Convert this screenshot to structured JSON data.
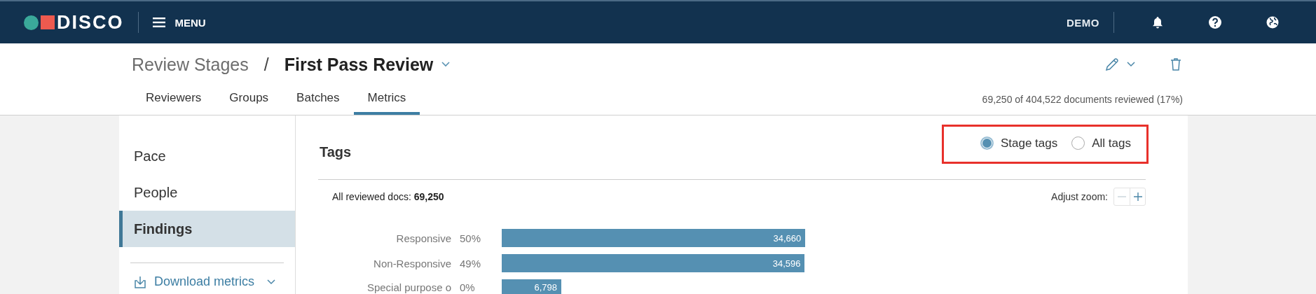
{
  "header": {
    "logo": "DISCO",
    "menu": "MENU",
    "user": "DEMO"
  },
  "breadcrumb": {
    "parent": "Review Stages",
    "separator": "/",
    "current": "First Pass Review"
  },
  "tabs": [
    {
      "label": "Reviewers",
      "selected": false
    },
    {
      "label": "Groups",
      "selected": false
    },
    {
      "label": "Batches",
      "selected": false
    },
    {
      "label": "Metrics",
      "selected": true
    }
  ],
  "progress_text": "69,250 of 404,522 documents reviewed (17%)",
  "sidebar": {
    "items": [
      {
        "label": "Pace",
        "selected": false
      },
      {
        "label": "People",
        "selected": false
      },
      {
        "label": "Findings",
        "selected": true
      }
    ],
    "download": "Download metrics"
  },
  "panel": {
    "title": "Tags",
    "radios": [
      {
        "label": "Stage tags",
        "selected": true
      },
      {
        "label": "All tags",
        "selected": false
      }
    ],
    "summary": "All reviewed docs: **69,250**",
    "zoom_label": "Adjust zoom:",
    "rows": [
      {
        "label": "Responsive",
        "percent": "50%",
        "count": "34,660"
      },
      {
        "label": "Non-Responsive",
        "percent": "49%",
        "count": "34,596"
      },
      {
        "label": "Special purpose o",
        "percent": "0%",
        "count": "6,798"
      }
    ]
  }
}
